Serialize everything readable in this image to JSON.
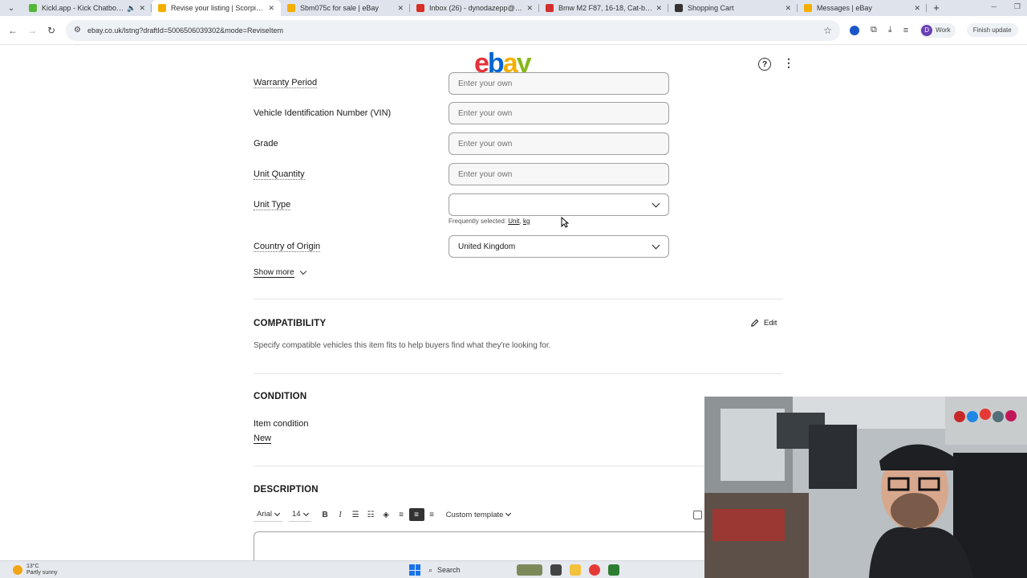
{
  "browser": {
    "tabs": [
      {
        "title": "Kickl.app - Kick Chatbot a",
        "active": false,
        "favicon_color": "#53b83a",
        "extra": "speaker"
      },
      {
        "title": "Revise your listing | Scorpion R",
        "active": true,
        "favicon_color": "#f5af02"
      },
      {
        "title": "Sbm075c for sale | eBay",
        "active": false,
        "favicon_color": "#f5af02"
      },
      {
        "title": "Inbox (26) - dynodazepp@gm",
        "active": false,
        "favicon_color": "#d93025"
      },
      {
        "title": "Bmw M2 F87, 16-18, Cat-back",
        "active": false,
        "favicon_color": "#d32f2f"
      },
      {
        "title": "Shopping Cart",
        "active": false,
        "favicon_color": "#333333"
      },
      {
        "title": "Messages | eBay",
        "active": false,
        "favicon_color": "#f5af02"
      }
    ],
    "url": "ebay.co.uk/lstng?draftId=5006506039302&mode=ReviseItem",
    "profile_initial": "D",
    "profile_label": "Work",
    "finish_update_label": "Finish update"
  },
  "header": {
    "logo_letters": [
      "e",
      "b",
      "a",
      "y"
    ],
    "help_symbol": "?",
    "menu_symbol": "⋮"
  },
  "specifics": {
    "partial_row": {
      "label": "Warranty Period",
      "placeholder": "Enter your own"
    },
    "rows": [
      {
        "label": "Vehicle Identification Number (VIN)",
        "placeholder": "Enter your own"
      },
      {
        "label": "Grade",
        "placeholder": "Enter your own"
      },
      {
        "label": "Unit Quantity",
        "placeholder": "Enter your own"
      }
    ],
    "unit_type": {
      "label": "Unit Type",
      "value": ""
    },
    "frequently_selected": {
      "prefix": "Frequently selected:",
      "options": [
        "Unit",
        "kg"
      ]
    },
    "country": {
      "label": "Country of Origin",
      "value": "United Kingdom"
    },
    "show_more": "Show more"
  },
  "compatibility": {
    "title": "COMPATIBILITY",
    "edit_label": "Edit",
    "description": "Specify compatible vehicles this item fits to help buyers find what they're looking for."
  },
  "condition": {
    "title": "CONDITION",
    "label": "Item condition",
    "value": "New"
  },
  "description": {
    "title": "DESCRIPTION",
    "font": "Arial",
    "size": "14",
    "template": "Custom template"
  },
  "taskbar": {
    "temperature": "13°C",
    "weather": "Partly sunny",
    "search": "Search"
  }
}
